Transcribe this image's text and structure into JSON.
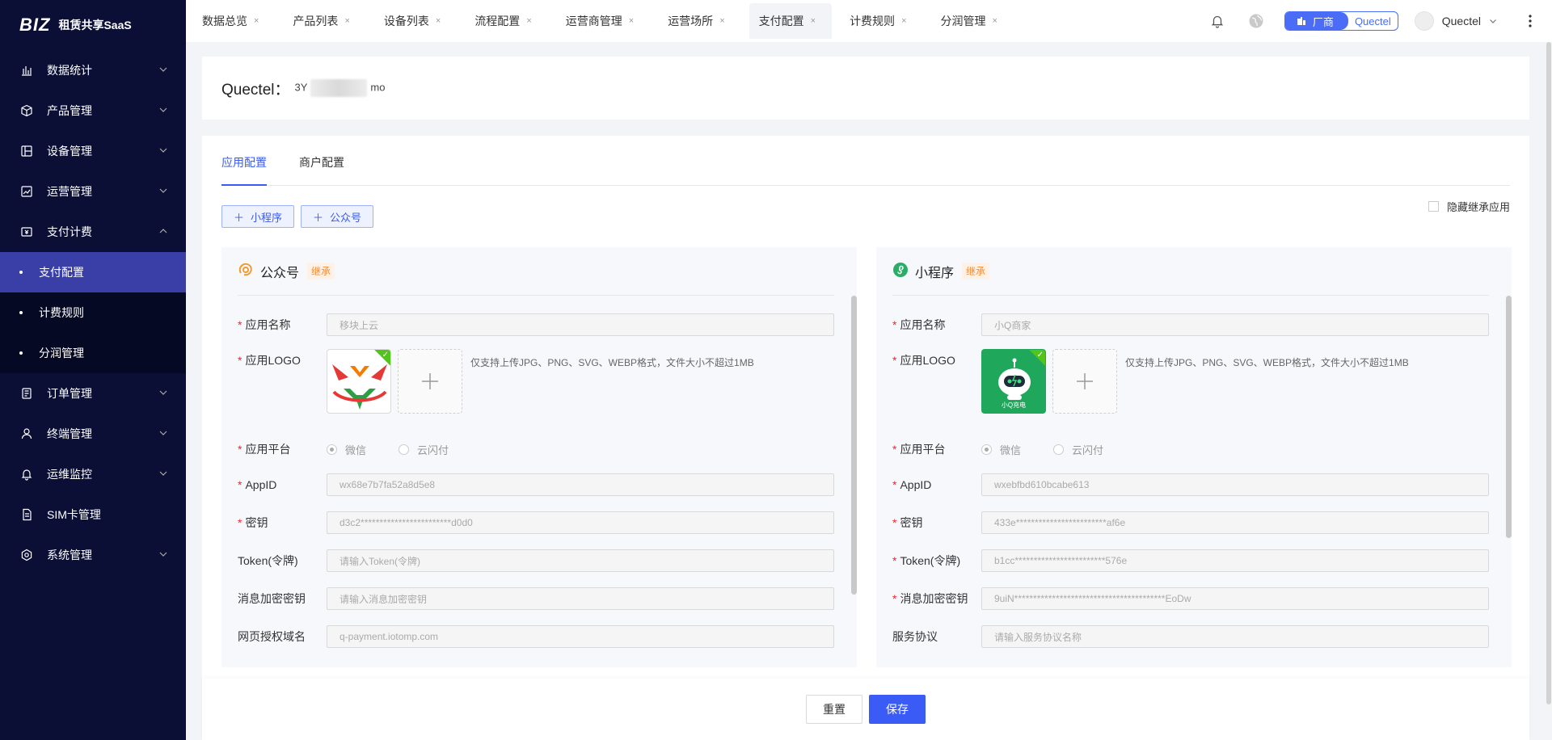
{
  "app": {
    "logo_text": "BIZ",
    "logo_sub": "租赁共享SaaS"
  },
  "sidebar": {
    "items": [
      {
        "label": "数据统计",
        "icon": "bar-chart-icon"
      },
      {
        "label": "产品管理",
        "icon": "cube-icon"
      },
      {
        "label": "设备管理",
        "icon": "device-icon"
      },
      {
        "label": "运营管理",
        "icon": "trend-chart-icon"
      },
      {
        "label": "支付计费",
        "icon": "payment-icon"
      }
    ],
    "sub_items": [
      {
        "label": "支付配置",
        "active": true
      },
      {
        "label": "计费规则",
        "active": false
      },
      {
        "label": "分润管理",
        "active": false
      }
    ],
    "items_after": [
      {
        "label": "订单管理",
        "icon": "order-icon"
      },
      {
        "label": "终端管理",
        "icon": "user-icon"
      },
      {
        "label": "运维监控",
        "icon": "bell-icon"
      },
      {
        "label": "SIM卡管理",
        "icon": "sim-card-icon"
      },
      {
        "label": "系统管理",
        "icon": "gear-icon"
      }
    ]
  },
  "tabs": [
    {
      "label": "数据总览"
    },
    {
      "label": "产品列表"
    },
    {
      "label": "设备列表"
    },
    {
      "label": "流程配置"
    },
    {
      "label": "运营商管理"
    },
    {
      "label": "运营场所"
    },
    {
      "label": "支付配置",
      "active": true
    },
    {
      "label": "计费规则"
    },
    {
      "label": "分润管理"
    }
  ],
  "header": {
    "role_vendor": "厂商",
    "role_name": "Quectel",
    "user_name": "Quectel",
    "tab_close": "×"
  },
  "merchant": {
    "label": "Quectel：",
    "id_prefix": "3Y",
    "id_suffix": "mo"
  },
  "config_tabs": {
    "app": "应用配置",
    "merchant": "商户配置"
  },
  "actions": {
    "add_mini": "小程序",
    "add_official": "公众号",
    "hide_inherit": "隐藏继承应用",
    "reset": "重置",
    "save": "保存"
  },
  "labels": {
    "app_name": "应用名称",
    "app_logo": "应用LOGO",
    "platform": "应用平台",
    "appid": "AppID",
    "secret": "密钥",
    "token": "Token(令牌)",
    "aes_key": "消息加密密钥",
    "web_domain": "网页授权域名",
    "service_agreement": "服务协议",
    "upload_tip": "仅支持上传JPG、PNG、SVG、WEBP格式，文件大小不超过1MB",
    "wechat": "微信",
    "unionpay": "云闪付",
    "inherit": "继承",
    "required_mark": "*"
  },
  "official_account": {
    "title": "公众号",
    "app_name": "移块上云",
    "appid": "wx68e7b7fa52a8d5e8",
    "secret": "d3c2************************d0d0",
    "token_placeholder": "请输入Token(令牌)",
    "aes_placeholder": "请输入消息加密密钥",
    "web_domain": "q-payment.iotomp.com"
  },
  "mini_program": {
    "title": "小程序",
    "app_name": "小Q商家",
    "appid": "wxebfbd610bcabe613",
    "secret": "433e************************af6e",
    "token": "b1cc************************576e",
    "aes_key": "9uiN****************************************EoDw",
    "agreement_placeholder": "请输入服务协议名称",
    "logo_caption": "小Q充电"
  },
  "colors": {
    "primary": "#3a5bf5",
    "sidebar": "#0b0f36",
    "active": "#3a3fa7",
    "inherit": "#f58a2e"
  }
}
